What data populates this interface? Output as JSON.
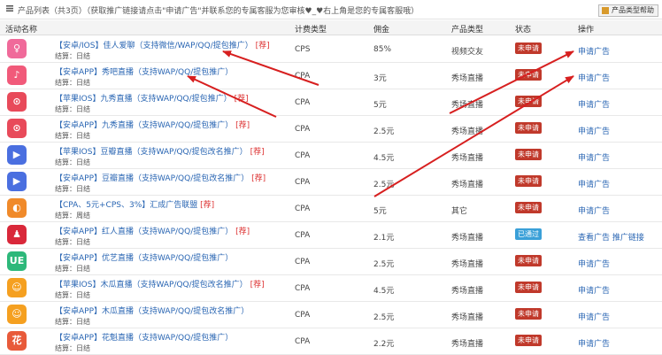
{
  "header": {
    "title_prefix": "产品列表（共3页）",
    "title_text": "（获取推广链接请点击\"申请广告\"并联系您的专属客服为您审核",
    "title_suffix": "♥_♥右上角是您的专属客服哦）",
    "button_label": "产品类型帮助"
  },
  "columns": {
    "name": "活动名称",
    "billing": "计费类型",
    "commission": "佣金",
    "type": "产品类型",
    "status": "状态",
    "action": "操作"
  },
  "colors": {
    "pending": "#c0392b",
    "approved": "#3aa0d8",
    "link": "#2a66b3",
    "arrow": "#d71f1f"
  },
  "rows": [
    {
      "icon": "pink-dancer-icon",
      "icon_color": "#f06a9a",
      "name": "【安卓/IOS】佳人爱聊（支持微信/WAP/QQ/提包推广）",
      "tag": "[荐]",
      "settle": "结算：日结",
      "billing": "CPS",
      "commission": "85%",
      "type": "视频交友",
      "status": "未申请",
      "status_kind": "pending",
      "action": "申请广告"
    },
    {
      "icon": "pink-anchor-icon",
      "icon_color": "#f15a7a",
      "name": "【安卓APP】秀吧直播（支持WAP/QQ/提包推广）",
      "tag": "",
      "settle": "结算：日结",
      "billing": "CPA",
      "commission": "3元",
      "type": "秀场直播",
      "status": "未申请",
      "status_kind": "pending",
      "action": "申请广告"
    },
    {
      "icon": "red-pin-icon",
      "icon_color": "#e84a5a",
      "name": "【苹果IOS】九秀直播（支持WAP/QQ/提包推广）",
      "tag": "[荐]",
      "settle": "结算：日结",
      "billing": "CPA",
      "commission": "5元",
      "type": "秀场直播",
      "status": "未申请",
      "status_kind": "pending",
      "action": "申请广告"
    },
    {
      "icon": "red-pin-icon",
      "icon_color": "#e84a5a",
      "name": "【安卓APP】九秀直播（支持WAP/QQ/提包推广）",
      "tag": "[荐]",
      "settle": "结算：日结",
      "billing": "CPA",
      "commission": "2.5元",
      "type": "秀场直播",
      "status": "未申请",
      "status_kind": "pending",
      "action": "申请广告"
    },
    {
      "icon": "blue-play-icon",
      "icon_color": "#4a6fe0",
      "name": "【苹果IOS】豆瓣直播（支持WAP/QQ/提包改名推广）",
      "tag": "[荐]",
      "settle": "结算：日结",
      "billing": "CPA",
      "commission": "4.5元",
      "type": "秀场直播",
      "status": "未申请",
      "status_kind": "pending",
      "action": "申请广告"
    },
    {
      "icon": "blue-play-icon",
      "icon_color": "#4a6fe0",
      "name": "【安卓APP】豆瓣直播（支持WAP/QQ/提包改名推广）",
      "tag": "[荐]",
      "settle": "结算：日结",
      "billing": "CPA",
      "commission": "2.5元",
      "type": "秀场直播",
      "status": "未申请",
      "status_kind": "pending",
      "action": "申请广告"
    },
    {
      "icon": "orange-swirl-icon",
      "icon_color": "#f08a2a",
      "name": "【CPA、5元+CPS、3%】汇成广告联盟",
      "tag": "[荐]",
      "settle": "结算：周结",
      "billing": "CPA",
      "commission": "5元",
      "type": "其它",
      "status": "未申请",
      "status_kind": "pending",
      "action": "申请广告"
    },
    {
      "icon": "red-person-icon",
      "icon_color": "#d9283a",
      "name": "【安卓APP】红人直播（支持WAP/QQ/提包推广）",
      "tag": "[荐]",
      "settle": "结算：日结",
      "billing": "CPA",
      "commission": "2.1元",
      "type": "秀场直播",
      "status": "已通过",
      "status_kind": "approved",
      "action": "查看广告  推广链接"
    },
    {
      "icon": "green-ue-icon",
      "icon_color": "#2db87a",
      "name": "【安卓APP】优艺直播（支持WAP/QQ/提包推广）",
      "tag": "",
      "settle": "结算：日结",
      "billing": "CPA",
      "commission": "2.5元",
      "type": "秀场直播",
      "status": "未申请",
      "status_kind": "pending",
      "action": "申请广告"
    },
    {
      "icon": "orange-face-icon",
      "icon_color": "#f5a020",
      "name": "【苹果IOS】木瓜直播（支持WAP/QQ/提包改名推广）",
      "tag": "[荐]",
      "settle": "结算：日结",
      "billing": "CPA",
      "commission": "4.5元",
      "type": "秀场直播",
      "status": "未申请",
      "status_kind": "pending",
      "action": "申请广告"
    },
    {
      "icon": "orange-face-icon",
      "icon_color": "#f5a020",
      "name": "【安卓APP】木瓜直播（支持WAP/QQ/提包改名推广）",
      "tag": "",
      "settle": "结算：日结",
      "billing": "CPA",
      "commission": "2.5元",
      "type": "秀场直播",
      "status": "未申请",
      "status_kind": "pending",
      "action": "申请广告"
    },
    {
      "icon": "huadong-logo-icon",
      "icon_color": "#e85a3a",
      "name": "【安卓APP】花魁直播（支持WAP/QQ/提包推广）",
      "tag": "",
      "settle": "结算：日结",
      "billing": "CPA",
      "commission": "2.2元",
      "type": "秀场直播",
      "status": "未申请",
      "status_kind": "pending",
      "action": "申请广告"
    }
  ]
}
